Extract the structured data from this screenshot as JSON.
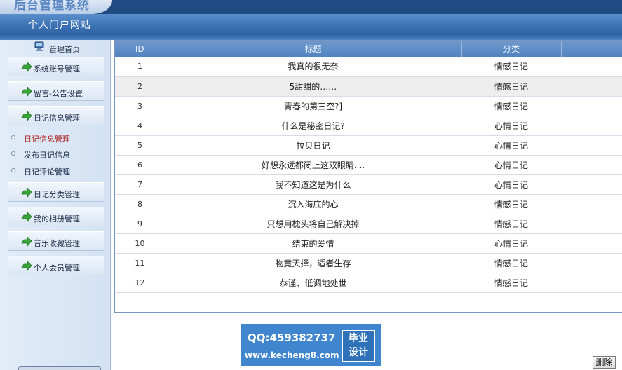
{
  "header": {
    "system_title": "后台管理系统",
    "site_title": "个人门户网站"
  },
  "sidebar": {
    "home_label": "管理首页",
    "menu": [
      {
        "label": "系统账号管理"
      },
      {
        "label": "留言-公告设置"
      },
      {
        "label": "日记信息管理"
      },
      {
        "label": "日记分类管理"
      },
      {
        "label": "我的相册管理"
      },
      {
        "label": "音乐收藏管理"
      },
      {
        "label": "个人会员管理"
      }
    ],
    "submenu": [
      {
        "label": "日记信息管理",
        "active": true
      },
      {
        "label": "发布日记信息",
        "active": false
      },
      {
        "label": "日记评论管理",
        "active": false
      }
    ]
  },
  "table": {
    "columns": [
      "ID",
      "标题",
      "分类"
    ],
    "rows": [
      {
        "id": "1",
        "title": "我真的很无奈",
        "category": "情感日记"
      },
      {
        "id": "2",
        "title": "5甜甜的……",
        "category": "情感日记"
      },
      {
        "id": "3",
        "title": "青春的第三空?]",
        "category": "情感日记"
      },
      {
        "id": "4",
        "title": "什么是秘密日记?",
        "category": "心情日记"
      },
      {
        "id": "5",
        "title": "拉贝日记",
        "category": "心情日记"
      },
      {
        "id": "6",
        "title": "好想永远都闭上这双眼睛....",
        "category": "心情日记"
      },
      {
        "id": "7",
        "title": "我不知道这是为什么",
        "category": "心情日记"
      },
      {
        "id": "8",
        "title": "沉入海底的心",
        "category": "情感日记"
      },
      {
        "id": "9",
        "title": "只想用枕头将自己解决掉",
        "category": "情感日记"
      },
      {
        "id": "10",
        "title": "结束的爱情",
        "category": "心情日记"
      },
      {
        "id": "11",
        "title": "物竟天择，适者生存",
        "category": "情感日记"
      },
      {
        "id": "12",
        "title": "恭谨、低调地处世",
        "category": "情感日记"
      }
    ]
  },
  "watermark": {
    "qq": "QQ:459382737",
    "url": "www.kecheng8.com",
    "badge_line1": "毕业",
    "badge_line2": "设计"
  },
  "actions": {
    "delete_label": "删除"
  },
  "colors": {
    "header_bg": "#1f4b82",
    "table_header": "#5b8cc7",
    "alt_row": "#eeeeee",
    "sidebar_bg": "#dbe7f5"
  }
}
